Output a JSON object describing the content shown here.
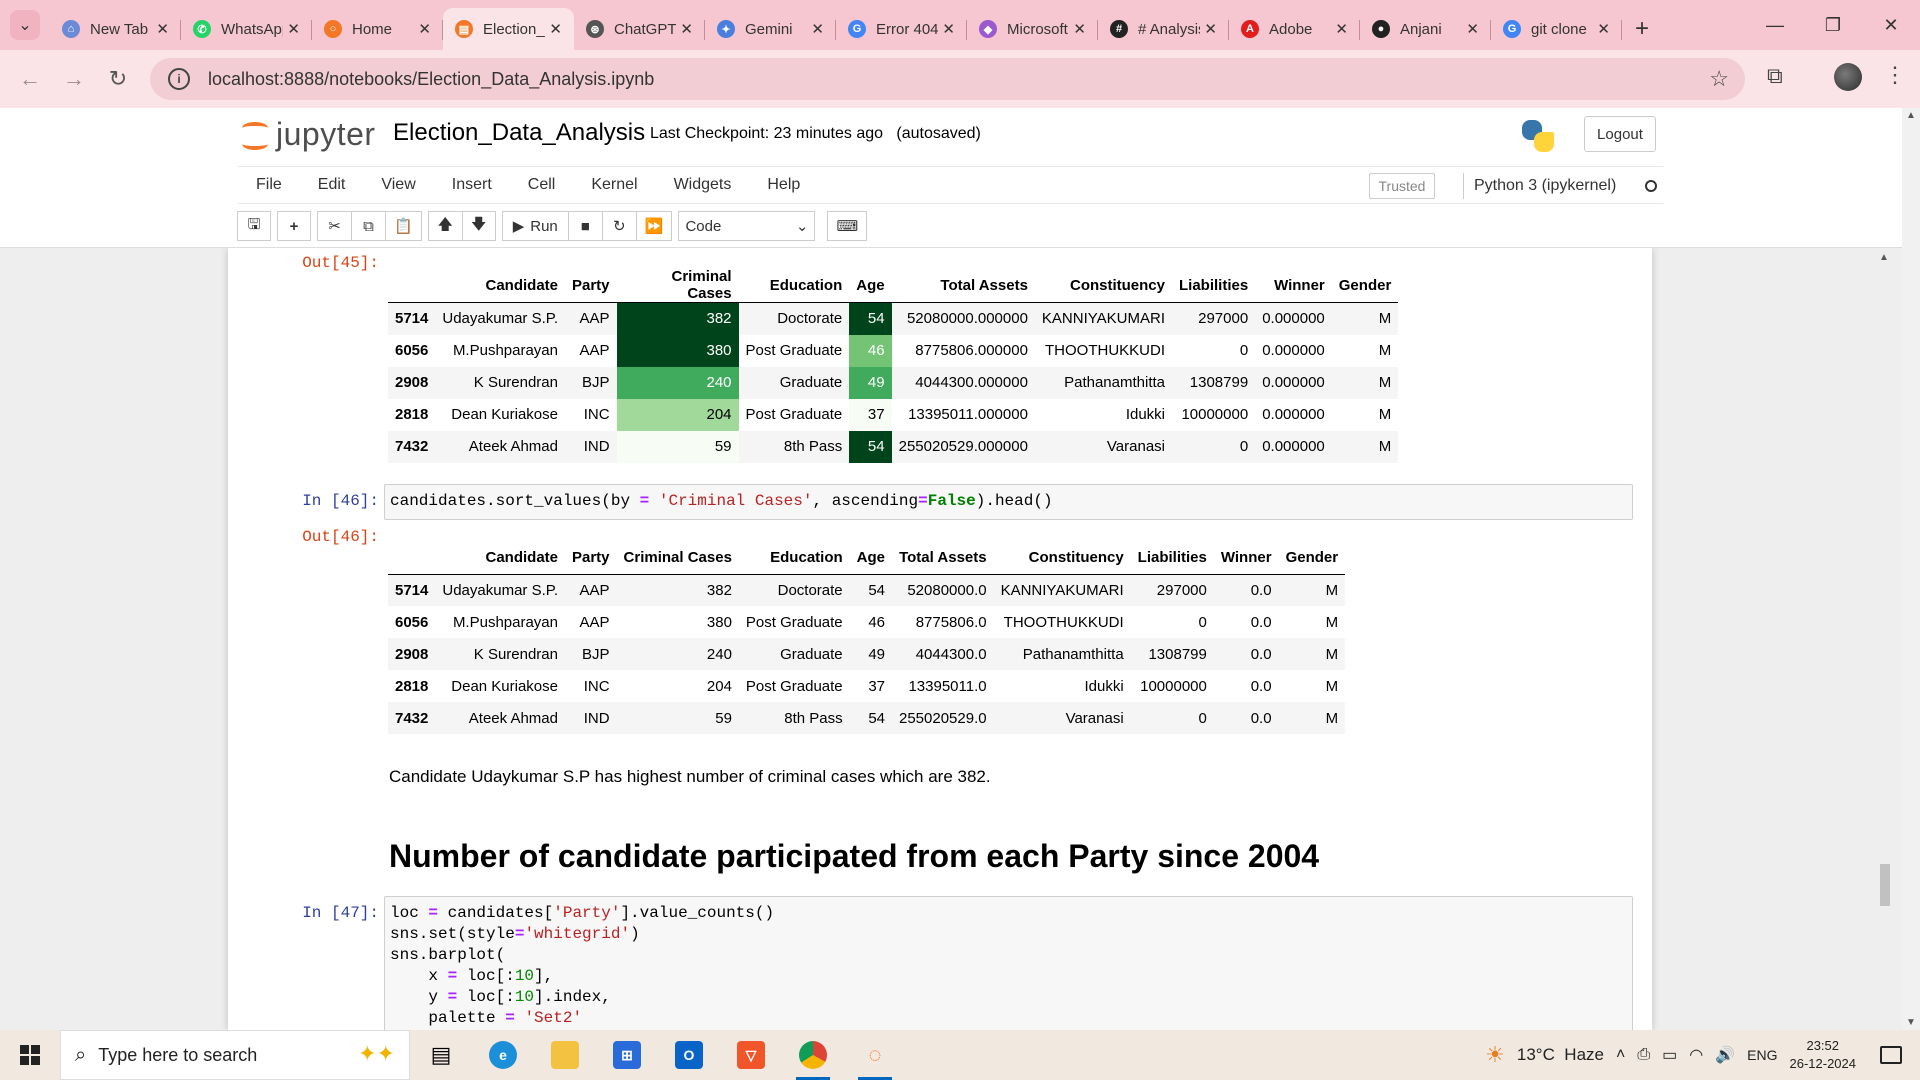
{
  "browser": {
    "tabs": [
      {
        "title": "New Tab",
        "icon": "new-tab-icon",
        "color": "#6b8bd6",
        "glyph": "⌂"
      },
      {
        "title": "WhatsApp",
        "icon": "whatsapp-icon",
        "color": "#25d366",
        "glyph": "✆"
      },
      {
        "title": "Home",
        "icon": "jupyter-home-icon",
        "color": "#f37726",
        "glyph": "○"
      },
      {
        "title": "Election_Data_Analysis",
        "icon": "jupyter-notebook-icon",
        "color": "#f37726",
        "glyph": "▤",
        "active": true
      },
      {
        "title": "ChatGPT",
        "icon": "chatgpt-icon",
        "color": "#555555",
        "glyph": "⊛"
      },
      {
        "title": "Gemini",
        "icon": "gemini-icon",
        "color": "#4a7fe0",
        "glyph": "✦"
      },
      {
        "title": "Error 404",
        "icon": "google-icon",
        "color": "#4285f4",
        "glyph": "G"
      },
      {
        "title": "Microsoft",
        "icon": "microsoft-copilot-icon",
        "color": "#9b59d0",
        "glyph": "◆"
      },
      {
        "title": "# Analysis",
        "icon": "kaggle-icon",
        "color": "#222222",
        "glyph": "#"
      },
      {
        "title": "Adobe",
        "icon": "adobe-icon",
        "color": "#e01e1e",
        "glyph": "A"
      },
      {
        "title": "Anjani",
        "icon": "github-icon",
        "color": "#222222",
        "glyph": "●"
      },
      {
        "title": "git clone",
        "icon": "google-icon",
        "color": "#4285f4",
        "glyph": "G"
      }
    ],
    "url": "localhost:8888/notebooks/Election_Data_Analysis.ipynb"
  },
  "jupyter": {
    "logo_text": "jupyter",
    "notebook_name": "Election_Data_Analysis",
    "checkpoint": "Last Checkpoint: 23 minutes ago   (autosaved)",
    "logout": "Logout",
    "menu": [
      "File",
      "Edit",
      "View",
      "Insert",
      "Cell",
      "Kernel",
      "Widgets",
      "Help"
    ],
    "trusted": "Trusted",
    "kernel": "Python 3 (ipykernel)",
    "run_label": "Run",
    "cell_type": "Code"
  },
  "cells": {
    "out45_prompt": "Out[45]:",
    "in46_prompt": "In [46]:",
    "out46_prompt": "Out[46]:",
    "in47_prompt": "In [47]:",
    "markdown_text": "Candidate Udaykumar S.P has highest number of criminal cases which are 382.",
    "markdown_heading": "Number of candidate participated from each Party since 2004"
  },
  "table_columns": [
    "",
    "Candidate",
    "Party",
    "Criminal Cases",
    "Education",
    "Age",
    "Total Assets",
    "Constituency",
    "Liabilities",
    "Winner",
    "Gender"
  ],
  "table45_rows": [
    [
      "5714",
      "Udayakumar S.P.",
      "AAP",
      "382",
      "Doctorate",
      "54",
      "52080000.000000",
      "KANNIYAKUMARI",
      "297000",
      "0.000000",
      "M"
    ],
    [
      "6056",
      "M.Pushparayan",
      "AAP",
      "380",
      "Post Graduate",
      "46",
      "8775806.000000",
      "THOOTHUKKUDI",
      "0",
      "0.000000",
      "M"
    ],
    [
      "2908",
      "K Surendran",
      "BJP",
      "240",
      "Graduate",
      "49",
      "4044300.000000",
      "Pathanamthitta",
      "1308799",
      "0.000000",
      "M"
    ],
    [
      "2818",
      "Dean Kuriakose",
      "INC",
      "204",
      "Post Graduate",
      "37",
      "13395011.000000",
      "Idukki",
      "10000000",
      "0.000000",
      "M"
    ],
    [
      "7432",
      "Ateek Ahmad",
      "IND",
      "59",
      "8th Pass",
      "54",
      "255020529.000000",
      "Varanasi",
      "0",
      "0.000000",
      "M"
    ]
  ],
  "table45_styles": {
    "criminal": [
      "c-dark",
      "c-dark",
      "c-mid",
      "c-pale",
      "c-cream"
    ],
    "age": [
      "c-dark",
      "c-light",
      "c-mid",
      "c-cream",
      "c-dark"
    ]
  },
  "table46_rows": [
    [
      "5714",
      "Udayakumar S.P.",
      "AAP",
      "382",
      "Doctorate",
      "54",
      "52080000.0",
      "KANNIYAKUMARI",
      "297000",
      "0.0",
      "M"
    ],
    [
      "6056",
      "M.Pushparayan",
      "AAP",
      "380",
      "Post Graduate",
      "46",
      "8775806.0",
      "THOOTHUKKUDI",
      "0",
      "0.0",
      "M"
    ],
    [
      "2908",
      "K Surendran",
      "BJP",
      "240",
      "Graduate",
      "49",
      "4044300.0",
      "Pathanamthitta",
      "1308799",
      "0.0",
      "M"
    ],
    [
      "2818",
      "Dean Kuriakose",
      "INC",
      "204",
      "Post Graduate",
      "37",
      "13395011.0",
      "Idukki",
      "10000000",
      "0.0",
      "M"
    ],
    [
      "7432",
      "Ateek Ahmad",
      "IND",
      "59",
      "8th Pass",
      "54",
      "255020529.0",
      "Varanasi",
      "0",
      "0.0",
      "M"
    ]
  ],
  "taskbar": {
    "search_placeholder": "Type here to search",
    "weather": "13°C  Haze",
    "language": "ENG",
    "time": "23:52",
    "date": "26-12-2024"
  }
}
